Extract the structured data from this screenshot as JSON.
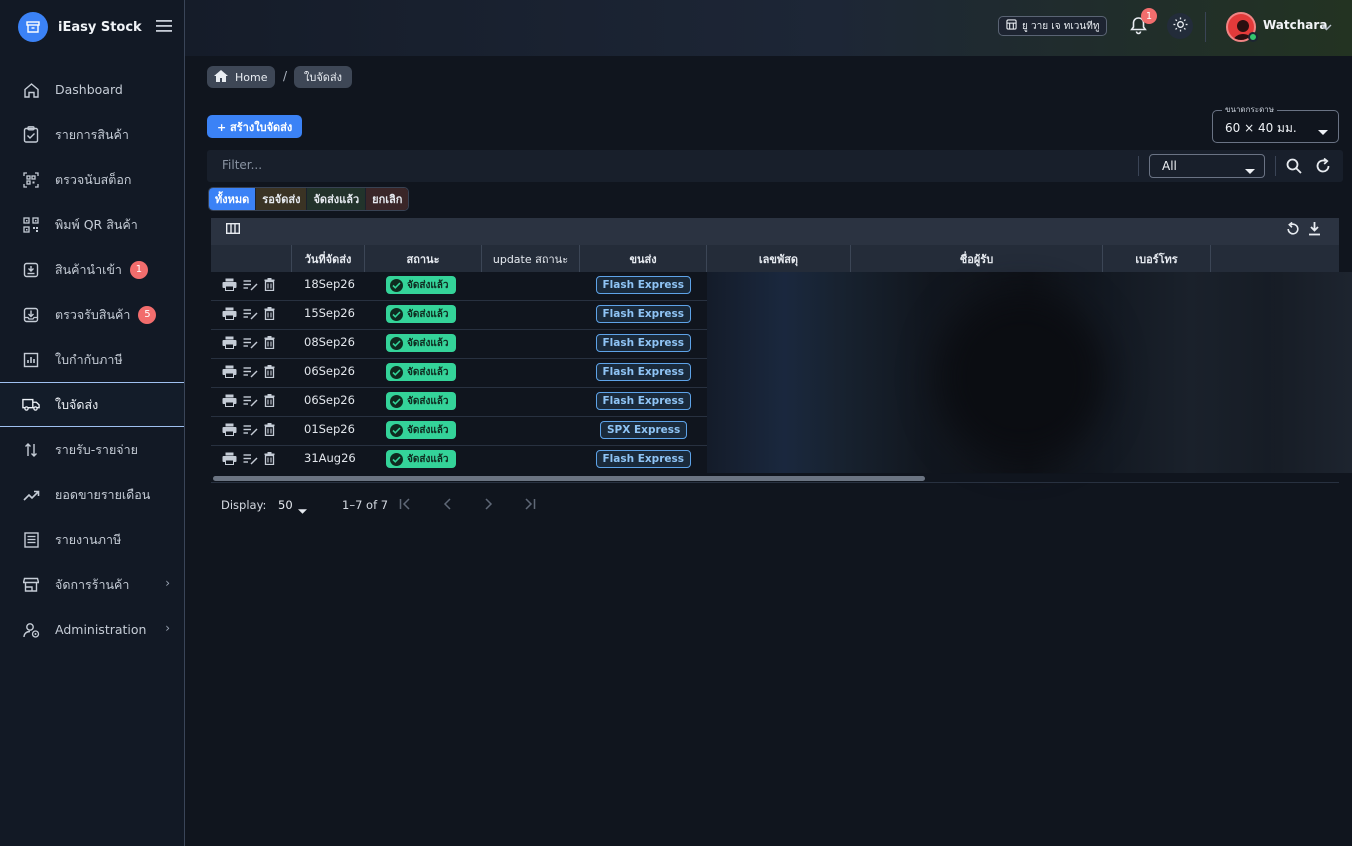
{
  "app": {
    "name": "iEasy Stock"
  },
  "sidebar": {
    "items": [
      {
        "label": "Dashboard",
        "icon": "home-icon"
      },
      {
        "label": "รายการสินค้า",
        "icon": "clipboard-check-icon"
      },
      {
        "label": "ตรวจนับสต็อก",
        "icon": "scan-qr-icon"
      },
      {
        "label": "พิมพ์ QR สินค้า",
        "icon": "qr-code-icon"
      },
      {
        "label": "สินค้านำเข้า",
        "icon": "import-box-icon",
        "badge": "1"
      },
      {
        "label": "ตรวจรับสินค้า",
        "icon": "receive-tray-icon",
        "badge": "5"
      },
      {
        "label": "ใบกำกับภาษี",
        "icon": "bar-chart-icon"
      },
      {
        "label": "ใบจัดส่ง",
        "icon": "truck-icon",
        "active": true
      },
      {
        "label": "รายรับ-รายจ่าย",
        "icon": "swap-vertical-icon"
      },
      {
        "label": "ยอดขายรายเดือน",
        "icon": "trending-up-icon"
      },
      {
        "label": "รายงานภาษี",
        "icon": "list-report-icon"
      },
      {
        "label": "จัดการร้านค้า",
        "icon": "store-icon",
        "chevron": "›"
      },
      {
        "label": "Administration",
        "icon": "admin-user-icon",
        "chevron": "›"
      }
    ]
  },
  "topbar": {
    "tenant": "ยู วาย เจ ทเวนทีทู",
    "notification_count": "1",
    "user_name": "Watchara"
  },
  "breadcrumb": {
    "home": "Home",
    "separator": "/",
    "current": "ใบจัดส่ง"
  },
  "actions": {
    "create_label": "+ สร้างใบจัดส่ง"
  },
  "paper_size": {
    "label": "ขนาดกระดาษ",
    "value": "60 × 40 มม."
  },
  "filter": {
    "placeholder": "Filter...",
    "select_value": "All"
  },
  "tabs": [
    {
      "label": "ทั้งหมด",
      "active": true
    },
    {
      "label": "รอจัดส่ง"
    },
    {
      "label": "จัดส่งแล้ว"
    },
    {
      "label": "ยกเลิก"
    }
  ],
  "table": {
    "columns": [
      "",
      "วันที่จัดส่ง",
      "สถานะ",
      "update สถานะ",
      "ขนส่ง",
      "เลขพัสดุ",
      "ชื่อผู้รับ",
      "เบอร์โทร",
      ""
    ],
    "rows": [
      {
        "date": "18Sep26",
        "status": "จัดส่งแล้ว",
        "carrier": "Flash Express"
      },
      {
        "date": "15Sep26",
        "status": "จัดส่งแล้ว",
        "carrier": "Flash Express"
      },
      {
        "date": "08Sep26",
        "status": "จัดส่งแล้ว",
        "carrier": "Flash Express"
      },
      {
        "date": "06Sep26",
        "status": "จัดส่งแล้ว",
        "carrier": "Flash Express"
      },
      {
        "date": "06Sep26",
        "status": "จัดส่งแล้ว",
        "carrier": "Flash Express"
      },
      {
        "date": "01Sep26",
        "status": "จัดส่งแล้ว",
        "carrier": "SPX Express"
      },
      {
        "date": "31Aug26",
        "status": "จัดส่งแล้ว",
        "carrier": "Flash Express"
      }
    ]
  },
  "pagination": {
    "display_label": "Display:",
    "page_size": "50",
    "range": "1–7 of 7"
  },
  "colors": {
    "accent": "#3b82f6",
    "success": "#34d399",
    "badge": "#f26d6d",
    "carrier_border": "#5ea3e8"
  }
}
